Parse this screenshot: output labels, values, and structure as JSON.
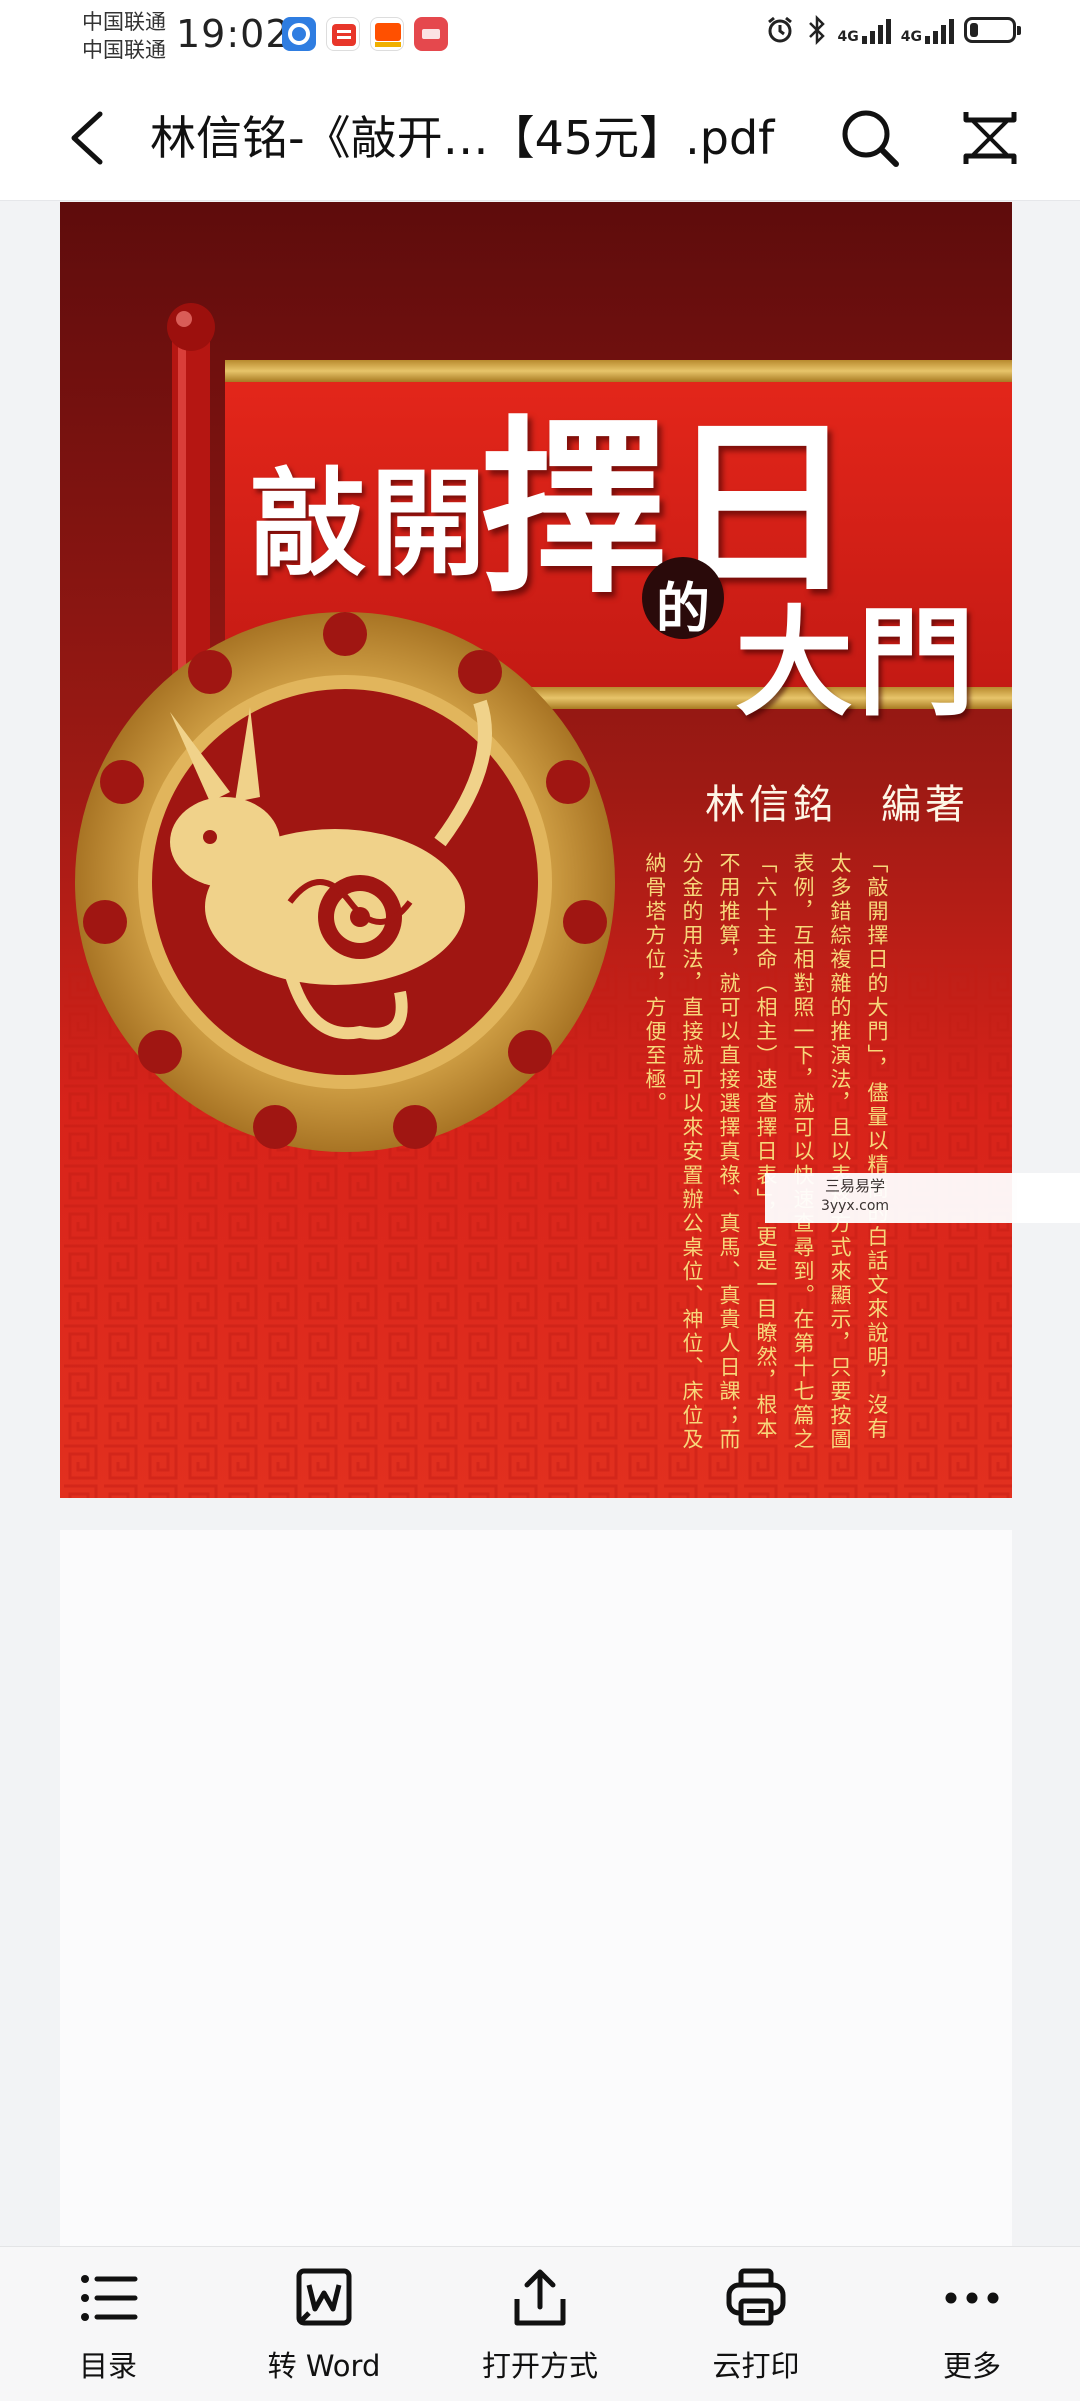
{
  "status_bar": {
    "carrier_1": "中国联通",
    "carrier_2": "中国联通",
    "time": "19:02",
    "app_icons": [
      "blue-app-icon",
      "taobao-deal-icon",
      "taobao-icon",
      "huawei-app-icon"
    ],
    "network_1": "4G",
    "network_2": "4G",
    "battery_level": 0.2
  },
  "header": {
    "title": "林信铭-《敲开…【45元】.pdf"
  },
  "cover": {
    "title_part1": "敲開",
    "title_part2": "擇日",
    "title_de": "的",
    "title_part3": "大門",
    "author": "林信銘　編著",
    "blurb": "「敲開擇日的大門」，儘量以精簡的白話文來說明，沒有太多錯綜複雜的推演法，且以表格方式來顯示，只要按圖表例，互相對照一下，就可以快速查尋到。在第十七篇之「六十主命（相主）速查擇日表」，更是一目瞭然，根本不用推算，就可以直接選擇真祿、真馬、真貴人日課；而分金的用法，直接就可以來安置辦公桌位、神位、床位及納骨塔方位，方便至極。",
    "watermark_line1": "三易易学",
    "watermark_line2": "3yyx.com"
  },
  "toolbar": {
    "items": [
      {
        "label": "目录",
        "icon": "list-icon"
      },
      {
        "label": "转 Word",
        "icon": "word-convert-icon"
      },
      {
        "label": "打开方式",
        "icon": "share-icon"
      },
      {
        "label": "云打印",
        "icon": "printer-icon"
      },
      {
        "label": "更多",
        "icon": "more-icon"
      }
    ]
  },
  "colors": {
    "cover_red": "#d8231a",
    "cover_dark_red": "#7a1212",
    "gold": "#d9a949",
    "background": "#f2f3f5"
  }
}
